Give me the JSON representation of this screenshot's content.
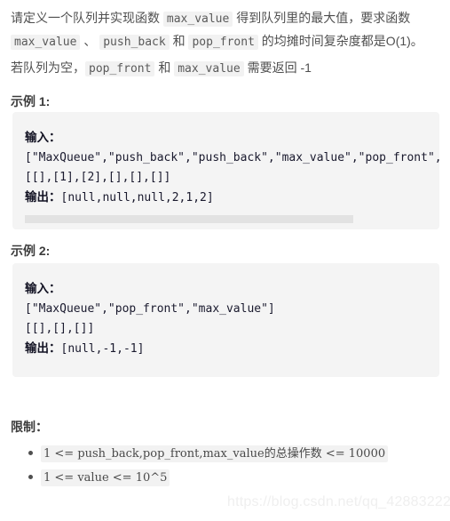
{
  "problem": {
    "description_line1_part1": "请定义一个队列并实现函数 ",
    "description_code1": "max_value",
    "description_line1_part2": " 得到队列里的最大值，要求函数 ",
    "description_code2": "max_value",
    "description_line1_part3": " 、 ",
    "description_code3": "push_back",
    "description_line1_part4": " 和 ",
    "description_code4": "pop_front",
    "description_line1_part5": " 的均摊时间复杂度都是O(1)。",
    "description_line2_part1": "若队列为空，",
    "description_line2_code1": "pop_front",
    "description_line2_part2": " 和 ",
    "description_line2_code2": "max_value",
    "description_line2_part3": " 需要返回 -1"
  },
  "examples": [
    {
      "heading": "示例 1:",
      "input_label": "输入：",
      "input_line1": "[\"MaxQueue\",\"push_back\",\"push_back\",\"max_value\",\"pop_front\",\"max_value\"]",
      "input_line2": "[[],[1],[2],[],[],[]]",
      "output_label": "输出：",
      "output_value": "[null,null,null,2,1,2]",
      "has_scrollbar": true
    },
    {
      "heading": "示例 2:",
      "input_label": "输入：",
      "input_line1": "[\"MaxQueue\",\"pop_front\",\"max_value\"]",
      "input_line2": "[[],[],[]]",
      "output_label": "输出：",
      "output_value": "[null,-1,-1]",
      "has_scrollbar": false
    }
  ],
  "limits": {
    "heading": "限制：",
    "items": [
      "1 <= push_back,pop_front,max_value的总操作数  <= 10000",
      "1 <= value <= 10^5"
    ]
  },
  "watermark": {
    "text": "https://blog.csdn.net/qq_42883222"
  },
  "colors": {
    "page_background": "#ffffff",
    "body_text": "#4f4f4f",
    "heading_text": "#3c3c3c",
    "inline_code_background": "#f2f2f2",
    "code_block_background": "#f4f4f4",
    "code_text": "#1a1a2e",
    "scrollbar_thumb": "#e2e2e2",
    "watermark_text": "#efefef"
  }
}
